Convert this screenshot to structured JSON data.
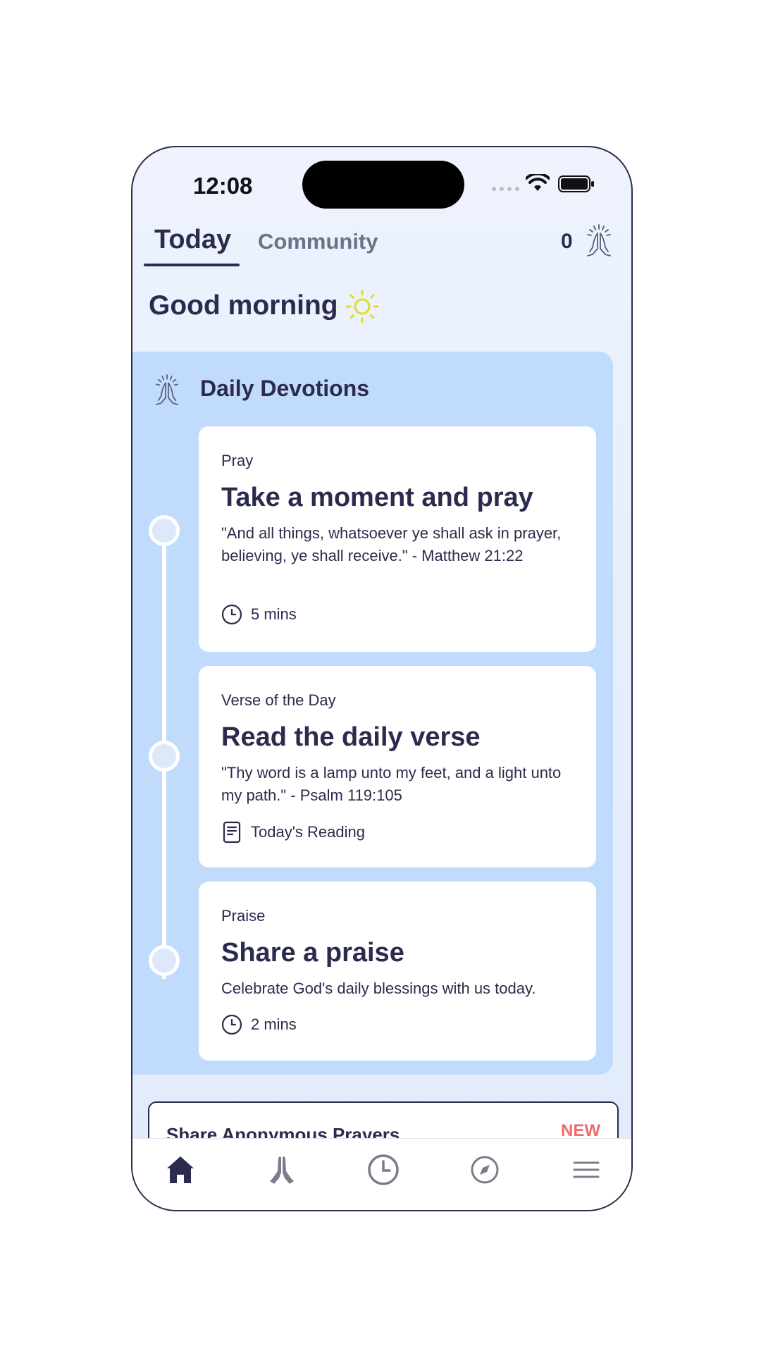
{
  "status_bar": {
    "time": "12:08"
  },
  "tabs": [
    {
      "label": "Today",
      "active": true
    },
    {
      "label": "Community",
      "active": false
    }
  ],
  "prayer_count": "0",
  "greeting": "Good morning",
  "devotions": {
    "title": "Daily Devotions",
    "items": [
      {
        "category": "Pray",
        "title": "Take a moment and pray",
        "description": "\"And all things, whatsoever ye shall ask in prayer, believing, ye shall receive.\" - Matthew 21:22",
        "meta_icon": "clock-icon",
        "meta": "5 mins"
      },
      {
        "category": "Verse of the Day",
        "title": "Read the daily verse",
        "description": "\"Thy word is a lamp unto my feet, and a light unto my path.\" - Psalm 119:105",
        "meta_icon": "document-icon",
        "meta": "Today's Reading"
      },
      {
        "category": "Praise",
        "title": "Share a praise",
        "description": "Celebrate God's daily blessings with us today.",
        "meta_icon": "clock-icon",
        "meta": "2 mins"
      }
    ]
  },
  "share_card": {
    "title": "Share Anonymous Prayers",
    "badge": "NEW"
  },
  "bottom_nav": [
    {
      "icon": "home-icon",
      "active": true
    },
    {
      "icon": "praying-hands-icon",
      "active": false
    },
    {
      "icon": "clock-icon",
      "active": false
    },
    {
      "icon": "compass-icon",
      "active": false
    },
    {
      "icon": "menu-icon",
      "active": false
    }
  ],
  "colors": {
    "primary": "#2b2b4d",
    "panel": "#c0dbfc",
    "badge": "#ef6b6b",
    "sun": "#e4dc20",
    "inactive": "#6e7087"
  }
}
